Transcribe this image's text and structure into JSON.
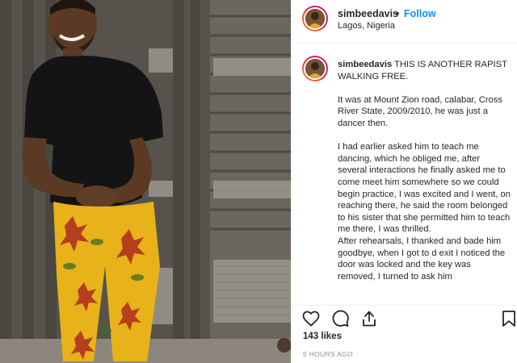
{
  "post": {
    "username": "simbeedavis",
    "separator": "•",
    "follow_label": "Follow",
    "location": "Lagos, Nigeria"
  },
  "caption": {
    "username": "simbeedavis",
    "headline": "THIS IS ANOTHER RAPIST WALKING FREE.",
    "paragraph_1": "It was at Mount Zion road, calabar, Cross River State, 2009/2010, he was just a dancer then.",
    "paragraph_2": "I had earlier asked him to teach me dancing, which he obliged me, after several interactions he finally asked me to come meet him somewhere so we could begin practice, I was excited and I went, on reaching there, he said the room belonged to his sister that she permitted him to teach me there, I was thrilled.",
    "paragraph_3": "After rehearsals, I thanked and bade him goodbye, when I got to d exit I noticed the door was locked and the key was removed, I turned to ask him"
  },
  "actions": {
    "like_icon": "heart-icon",
    "comment_icon": "comment-icon",
    "share_icon": "share-icon",
    "save_icon": "bookmark-icon"
  },
  "likes_text": "143 likes",
  "timestamp": "5 HOURS AGO",
  "colors": {
    "accent": "#0095f6",
    "text": "#262626",
    "muted": "#8e8e8e",
    "border": "#efefef"
  }
}
